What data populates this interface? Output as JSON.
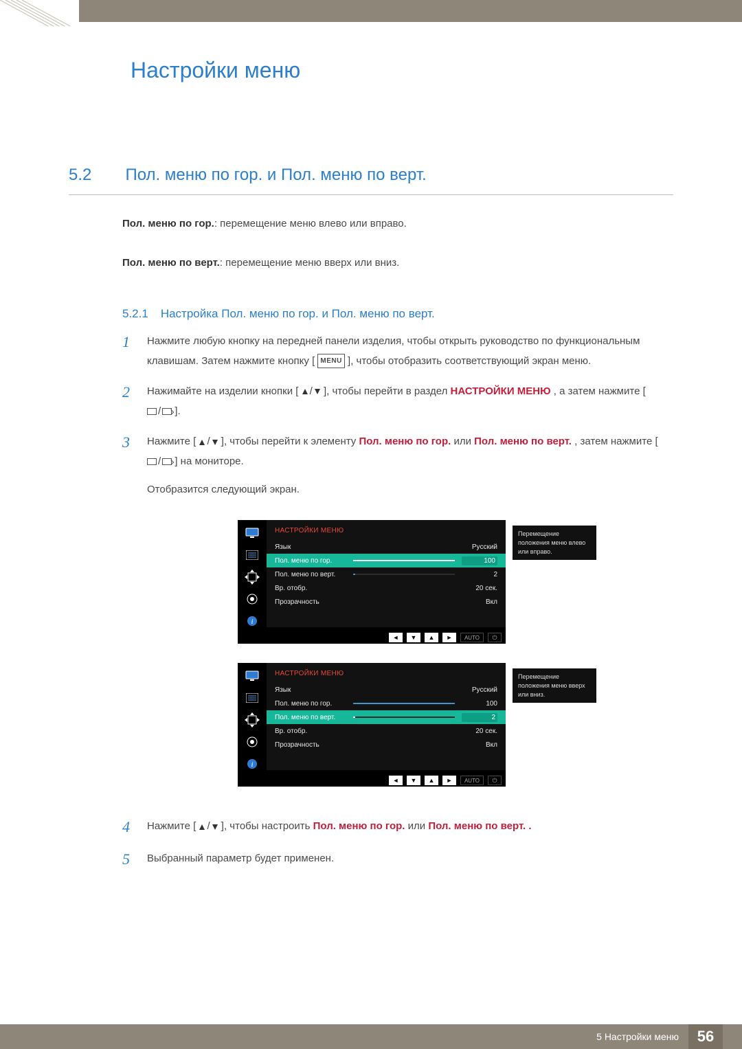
{
  "header": {
    "chapter_title": "Настройки меню"
  },
  "section": {
    "num": "5.2",
    "title": "Пол. меню по гор. и Пол. меню по верт.",
    "def1_label": "Пол. меню по гор.",
    "def1_text": ": перемещение меню влево или вправо.",
    "def2_label": "Пол. меню по верт.",
    "def2_text": ": перемещение меню вверх или вниз."
  },
  "subsection": {
    "num": "5.2.1",
    "title": "Настройка Пол. меню по гор. и Пол. меню по верт."
  },
  "steps": {
    "s1_a": "Нажмите любую кнопку на передней панели изделия, чтобы открыть руководство по функциональным клавишам. Затем нажмите кнопку [",
    "s1_menu": "MENU",
    "s1_b": "], чтобы отобразить соответствующий экран меню.",
    "s2_a": "Нажимайте на изделии кнопки [",
    "s2_b": "], чтобы перейти в раздел ",
    "s2_c": "НАСТРОЙКИ МЕНЮ",
    "s2_d": ", а затем нажмите [",
    "s2_e": "].",
    "s3_a": "Нажмите [",
    "s3_b": "], чтобы перейти к элементу ",
    "s3_c": "Пол. меню по гор.",
    "s3_d": " или ",
    "s3_e": "Пол. меню по верт.",
    "s3_f": ", затем нажмите [",
    "s3_g": "] на мониторе.",
    "s3_h": "Отобразится следующий экран.",
    "s4_a": "Нажмите [",
    "s4_b": "], чтобы настроить ",
    "s4_c": "Пол. меню по гор.",
    "s4_d": " или ",
    "s4_e": "Пол. меню по верт.",
    "s4_f": ".",
    "s5": "Выбранный параметр будет применен."
  },
  "nums": {
    "n1": "1",
    "n2": "2",
    "n3": "3",
    "n4": "4",
    "n5": "5"
  },
  "osd": {
    "header": "НАСТРОЙКИ МЕНЮ",
    "rows": [
      {
        "label": "Язык",
        "value": "Русский",
        "bar": null
      },
      {
        "label": "Пол. меню по гор.",
        "value": "100",
        "bar": 100
      },
      {
        "label": "Пол. меню по верт.",
        "value": "2",
        "bar": 2
      },
      {
        "label": "Вр. отобр.",
        "value": "20 сек.",
        "bar": null
      },
      {
        "label": "Прозрачность",
        "value": "Вкл",
        "bar": null
      }
    ],
    "desc1": "Перемещение положения меню влево или вправо.",
    "desc2": "Перемещение положения меню вверх или вниз.",
    "ctrl_auto": "AUTO"
  },
  "footer": {
    "label": "5 Настройки меню",
    "page": "56"
  }
}
